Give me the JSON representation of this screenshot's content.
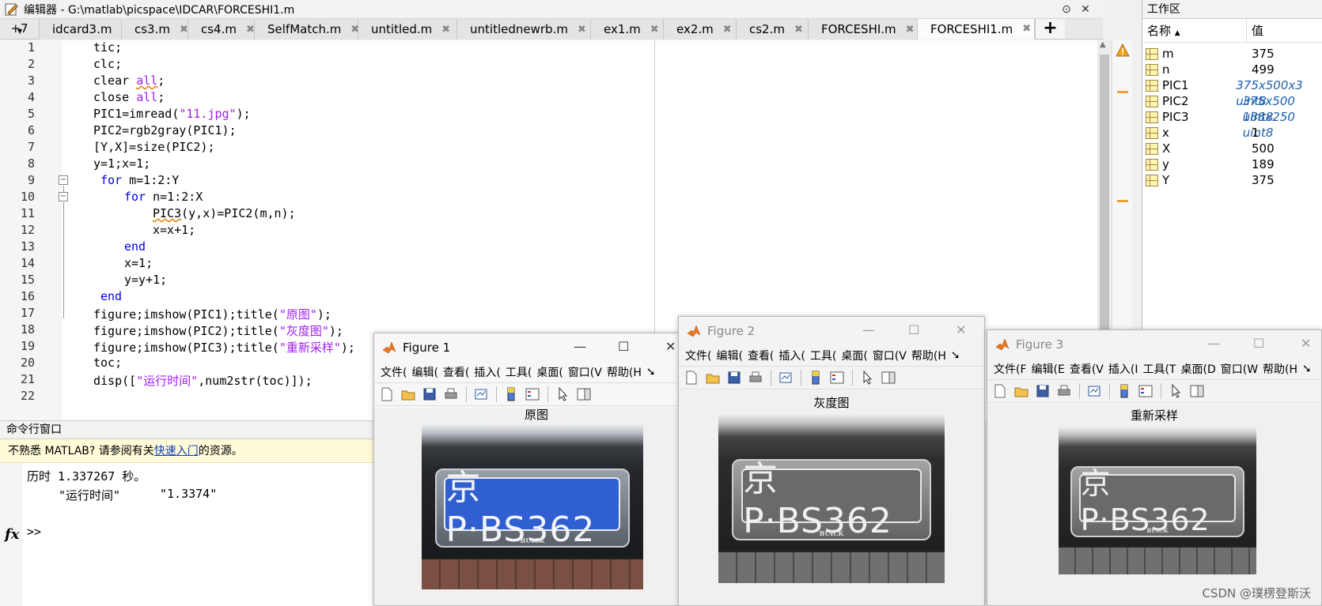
{
  "editor": {
    "title": "编辑器 - G:\\matlab\\picspace\\IDCAR\\FORCESHI1.m",
    "tabs_more": "+7",
    "tabs": [
      {
        "label": "idcard3.m"
      },
      {
        "label": "cs3.m"
      },
      {
        "label": "cs4.m"
      },
      {
        "label": "SelfMatch.m"
      },
      {
        "label": "untitled.m"
      },
      {
        "label": "untitlednewrb.m"
      },
      {
        "label": "ex1.m"
      },
      {
        "label": "ex2.m"
      },
      {
        "label": "cs2.m"
      },
      {
        "label": "FORCESHI.m"
      },
      {
        "label": "FORCESHI1.m",
        "active": true
      }
    ],
    "add_tab": "+",
    "line_numbers": [
      "1",
      "2",
      "3",
      "4",
      "5",
      "6",
      "7",
      "8",
      "9",
      "10",
      "11",
      "12",
      "13",
      "14",
      "15",
      "16",
      "17",
      "18",
      "19",
      "20",
      "21",
      "22"
    ],
    "code": {
      "l1": "tic;",
      "l2": "clc;",
      "l3_a": "clear ",
      "l3_b": "all",
      "l3_c": ";",
      "l4_a": "close ",
      "l4_b": "all",
      "l4_c": ";",
      "l5_a": "PIC1=imread(",
      "l5_b": "\"11.jpg\"",
      "l5_c": ");",
      "l6": "PIC2=rgb2gray(PIC1);",
      "l7": "[Y,X]=size(PIC2);",
      "l8": "y=1;x=1;",
      "l9_a": "for",
      "l9_b": " m=1:2:Y",
      "l10_a": "for",
      "l10_b": " n=1:2:X",
      "l11_a": "PIC3",
      "l11_b": "(y,x)=PIC2(m,n);",
      "l12": "x=x+1;",
      "l13": "end",
      "l14": "x=1;",
      "l15": "y=y+1;",
      "l16": "end",
      "l17_a": "figure;imshow(PIC1);title(",
      "l17_b": "\"原图\"",
      "l17_c": ");",
      "l18_a": "figure;imshow(PIC2);title(",
      "l18_b": "\"灰度图\"",
      "l18_c": ");",
      "l19_a": "figure;imshow(PIC3);title(",
      "l19_b": "\"重新采样\"",
      "l19_c": ");",
      "l20": "toc;",
      "l21_a": "disp([",
      "l21_b": "\"运行时间\"",
      "l21_c": ",num2str(toc)]);"
    }
  },
  "workspace": {
    "title": "工作区",
    "col_name": "名称",
    "col_value": "值",
    "vars": [
      {
        "name": "m",
        "value": "375"
      },
      {
        "name": "n",
        "value": "499"
      },
      {
        "name": "PIC1",
        "value": "375x500x3 uint8"
      },
      {
        "name": "PIC2",
        "value": "375x500 uint8"
      },
      {
        "name": "PIC3",
        "value": "188x250 uint8"
      },
      {
        "name": "x",
        "value": "1"
      },
      {
        "name": "X",
        "value": "500"
      },
      {
        "name": "y",
        "value": "189"
      },
      {
        "name": "Y",
        "value": "375"
      }
    ]
  },
  "command": {
    "title": "命令行窗口",
    "help_prefix": "不熟悉 MATLAB? 请参阅有关",
    "help_link": "快速入门",
    "help_suffix": "的资源。",
    "out1": "历时 1.337267 秒。",
    "out2_a": "\"运行时间\"",
    "out2_b": "\"1.3374\"",
    "prompt": ">>",
    "fx": "fx"
  },
  "figures": [
    {
      "title": "Figure 1",
      "caption": "原图",
      "menu": [
        "文件(",
        "编辑(",
        "查看(",
        "插入(",
        "工具(",
        "桌面(",
        "窗口(V",
        "帮助(H"
      ],
      "plate": "京P·BS362",
      "badge": "BUICK"
    },
    {
      "title": "Figure 2",
      "caption": "灰度图",
      "menu": [
        "文件(",
        "编辑(",
        "查看(",
        "插入(",
        "工具(",
        "桌面(",
        "窗口(V",
        "帮助(H"
      ],
      "plate": "京P·BS362",
      "badge": "BUICK"
    },
    {
      "title": "Figure 3",
      "caption": "重新采样",
      "menu": [
        "文件(F",
        "编辑(E",
        "查看(V",
        "插入(I",
        "工具(T",
        "桌面(D",
        "窗口(W",
        "帮助(H"
      ],
      "plate": "京P·BS362",
      "badge": "BUICK"
    }
  ],
  "watermark": "CSDN @璞楞登斯沃",
  "colors": {
    "plate_blue": "#2f5fd0",
    "accent": "#e87722"
  }
}
